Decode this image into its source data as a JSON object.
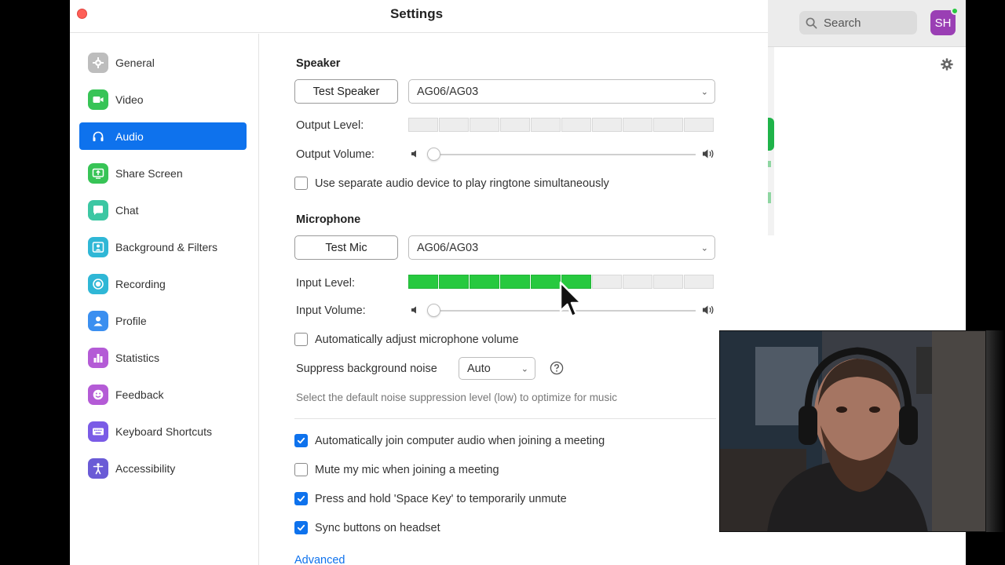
{
  "window": {
    "title": "Settings"
  },
  "background_app": {
    "search_label": "Search",
    "avatar_initials": "SH",
    "avatar_color": "#9a3fb4",
    "status_color": "#27c840"
  },
  "sidebar": {
    "items": [
      {
        "label": "General",
        "icon": "gear-icon",
        "color": "#bdbdbd",
        "active": false
      },
      {
        "label": "Video",
        "icon": "video-camera-icon",
        "color": "#37c456",
        "active": false
      },
      {
        "label": "Audio",
        "icon": "headphones-icon",
        "color": "#0e72ed",
        "active": true
      },
      {
        "label": "Share Screen",
        "icon": "share-screen-icon",
        "color": "#37c456",
        "active": false
      },
      {
        "label": "Chat",
        "icon": "chat-bubble-icon",
        "color": "#3cc7a3",
        "active": false
      },
      {
        "label": "Background & Filters",
        "icon": "person-background-icon",
        "color": "#2fb7d6",
        "active": false
      },
      {
        "label": "Recording",
        "icon": "record-icon",
        "color": "#2fb7d6",
        "active": false
      },
      {
        "label": "Profile",
        "icon": "person-icon",
        "color": "#3b8ff0",
        "active": false
      },
      {
        "label": "Statistics",
        "icon": "bar-chart-icon",
        "color": "#b45bd6",
        "active": false
      },
      {
        "label": "Feedback",
        "icon": "smiley-icon",
        "color": "#b45bd6",
        "active": false
      },
      {
        "label": "Keyboard Shortcuts",
        "icon": "keyboard-icon",
        "color": "#7a5be6",
        "active": false
      },
      {
        "label": "Accessibility",
        "icon": "accessibility-icon",
        "color": "#6a5bd6",
        "active": false
      }
    ]
  },
  "speaker": {
    "heading": "Speaker",
    "test_button": "Test Speaker",
    "device": "AG06/AG03",
    "output_level_label": "Output Level:",
    "output_level_segments_lit": 0,
    "output_volume_label": "Output Volume:",
    "output_volume_value": 0,
    "ringtone_checkbox": {
      "label": "Use separate audio device to play ringtone simultaneously",
      "checked": false
    }
  },
  "microphone": {
    "heading": "Microphone",
    "test_button": "Test Mic",
    "device": "AG06/AG03",
    "input_level_label": "Input Level:",
    "input_level_segments_lit": 6,
    "input_level_segments_total": 10,
    "input_volume_label": "Input Volume:",
    "input_volume_value": 0,
    "auto_adjust_checkbox": {
      "label": "Automatically adjust microphone volume",
      "checked": false
    },
    "suppress_label": "Suppress background noise",
    "suppress_value": "Auto",
    "suppress_hint": "Select the default noise suppression level (low) to optimize for music"
  },
  "options": [
    {
      "label": "Automatically join computer audio when joining a meeting",
      "checked": true
    },
    {
      "label": "Mute my mic when joining a meeting",
      "checked": false
    },
    {
      "label": "Press and hold 'Space Key' to temporarily unmute",
      "checked": true
    },
    {
      "label": "Sync buttons on headset",
      "checked": true
    }
  ],
  "advanced_link": "Advanced",
  "colors": {
    "accent": "#0e72ed",
    "meter_on": "#27c93f",
    "close": "#fe5f57"
  }
}
